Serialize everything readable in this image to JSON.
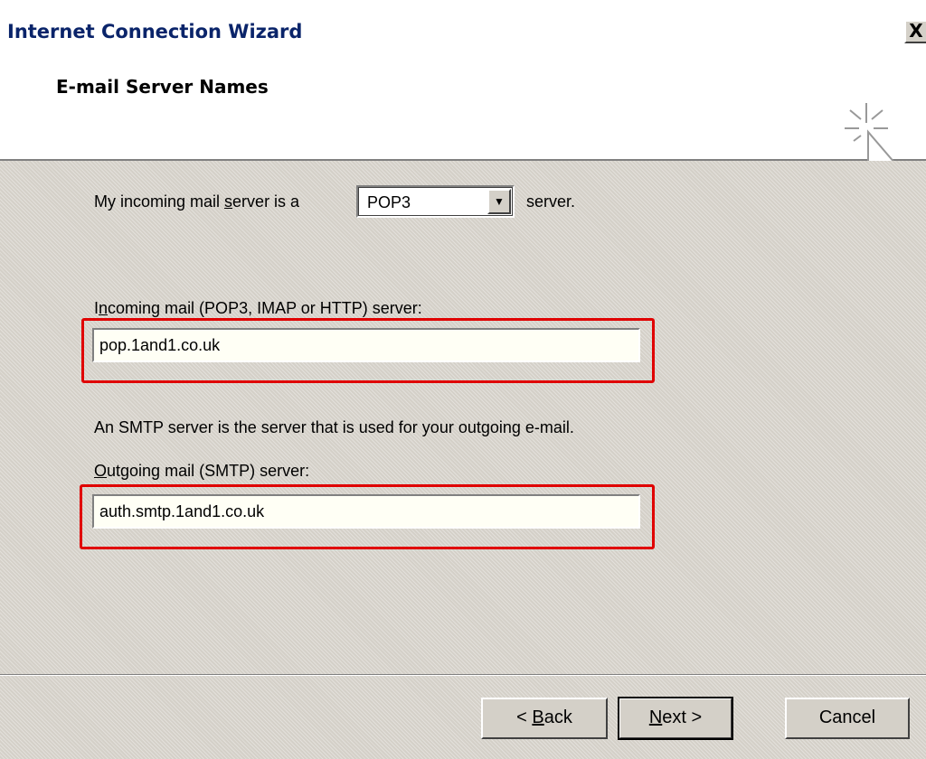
{
  "window": {
    "title": "Internet Connection Wizard",
    "close_label": "X"
  },
  "header": {
    "title": "E-mail Server Names",
    "icon": "wizard-cursor-icon"
  },
  "server_type": {
    "prefix_a": "My incoming mail ",
    "prefix_u": "s",
    "prefix_b": "erver is a",
    "selected": "POP3",
    "suffix": "server."
  },
  "incoming": {
    "label_a": "I",
    "label_u": "n",
    "label_b": "coming mail (POP3, IMAP or HTTP) server:",
    "value": "pop.1and1.co.uk"
  },
  "smtp_note": "An SMTP server is the server that is used for your outgoing e-mail.",
  "outgoing": {
    "label_u": "O",
    "label_b": "utgoing mail (SMTP) server:",
    "value": "auth.smtp.1and1.co.uk"
  },
  "buttons": {
    "back_a": "< ",
    "back_u": "B",
    "back_b": "ack",
    "next_u": "N",
    "next_b": "ext >",
    "cancel": "Cancel"
  },
  "colors": {
    "highlight": "#e00000",
    "dialog": "#d4d0c8"
  }
}
